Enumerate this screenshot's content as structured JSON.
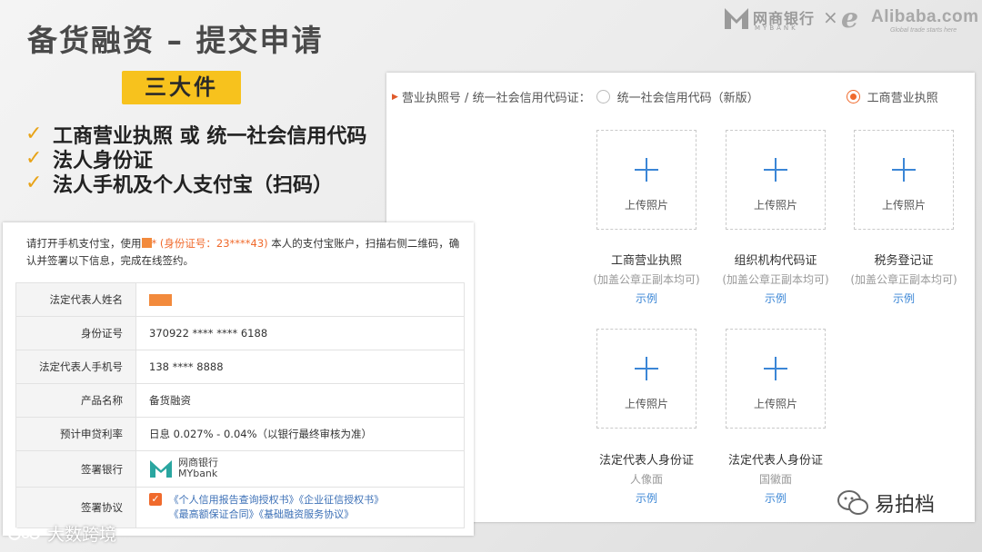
{
  "slide": {
    "title": "备货融资 – 提交申请",
    "badge": "三大件",
    "checklist": [
      "工商营业执照 或 统一社会信用代码",
      "法人身份证",
      "法人手机及个人支付宝（扫码）"
    ],
    "check_glyph": "✓"
  },
  "logos": {
    "mybank_cn": "网商银行",
    "mybank_en": "MYBANK",
    "times": "×",
    "alibaba_mark": "e",
    "alibaba_text": "Alibaba.com",
    "alibaba_tagline": "Global trade starts here"
  },
  "upload_form": {
    "license_label": "营业执照号 / 统一社会信用代码证：",
    "options": [
      {
        "label": "统一社会信用代码（新版）",
        "checked": false
      },
      {
        "label": "工商营业执照",
        "checked": true
      }
    ],
    "slot_label": "上传照片",
    "documents": [
      {
        "title": "工商营业执照",
        "note": "(加盖公章正副本均可)",
        "link": "示例"
      },
      {
        "title": "组织机构代码证",
        "note": "(加盖公章正副本均可)",
        "link": "示例"
      },
      {
        "title": "税务登记证",
        "note": "(加盖公章正副本均可)",
        "link": "示例"
      },
      {
        "title": "法定代表人身份证",
        "note": "人像面",
        "link": "示例"
      },
      {
        "title": "法定代表人身份证",
        "note": "国徽面",
        "link": "示例"
      }
    ]
  },
  "sign_form": {
    "instruction_pre": "请打开手机支付宝，使用",
    "instruction_id": "* (身份证号：23****43)",
    "instruction_post": " 本人的支付宝账户，扫描右侧二维码，确认并签署以下信息，完成在线签约。",
    "rows": [
      {
        "key": "法定代表人姓名",
        "value": ""
      },
      {
        "key": "身份证号",
        "value": "370922 **** **** 6188"
      },
      {
        "key": "法定代表人手机号",
        "value": "138 **** 8888"
      },
      {
        "key": "产品名称",
        "value": "备货融资"
      },
      {
        "key": "预计申贷利率",
        "value": "日息 0.027% - 0.04%（以银行最终审核为准）"
      },
      {
        "key": "签署银行",
        "value": ""
      },
      {
        "key": "签署协议",
        "value": ""
      }
    ],
    "bank_cn": "网商银行",
    "bank_en": "MYbank",
    "agreements_line1": "《个人信用报告查询授权书》《企业征信授权书》",
    "agreements_line2": "《最高额保证合同》《基础融资服务协议》"
  },
  "watermarks": {
    "left": "大数跨境",
    "right": "易拍档"
  },
  "colors": {
    "accent_yellow": "#f7c21d",
    "check_orange": "#e8a317",
    "link_blue": "#3b86d6",
    "radio_orange": "#f06a2c"
  }
}
